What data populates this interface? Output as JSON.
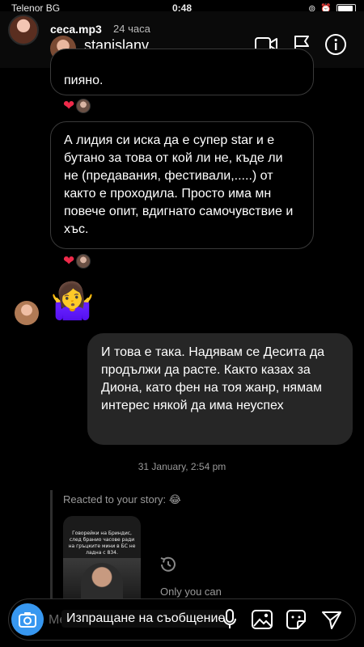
{
  "status_bar": {
    "carrier": "Telenor BG",
    "time": "0:48"
  },
  "header": {
    "story_user": "ceca.mp3",
    "story_age": "24 часа",
    "username": "stanislanv",
    "icons": [
      "video-call-icon",
      "flag-icon",
      "info-icon"
    ]
  },
  "messages": [
    {
      "id": "m1",
      "sender": "other",
      "text": "пияно.",
      "reaction": "heart"
    },
    {
      "id": "m2",
      "sender": "other",
      "text": "А лидия си иска да е супер star  и е бутано за това от кой ли не, къде ли не (предавания, фестивали,.....) от както е проходила. Просто има мн повече опит, вдигнато самочувствие и хъс.",
      "reaction": "heart"
    },
    {
      "id": "m3",
      "sender": "other",
      "text": "🤷‍♀️"
    },
    {
      "id": "m4",
      "sender": "me",
      "text": "И това е така. Надявам се Десита да продължи да расте. Както казах за Диона, като фен на тоя жанр, нямам интерес някой да има неуспех"
    }
  ],
  "timestamp": "31 January, 2:54 pm",
  "story_reply": {
    "label": "Reacted to your story: 😂",
    "thumb_text": "Говорейки на Бриндис, след бранио часове ради на гръцките мини в БС не ладна с 834.",
    "note": "Only you can"
  },
  "composer": {
    "placeholder": "Message...",
    "overlay_text": "Изпращане на съобщение",
    "icons": [
      "camera-icon",
      "microphone-icon",
      "gallery-icon",
      "sticker-icon",
      "send-icon"
    ]
  },
  "colors": {
    "accent": "#3797f0",
    "heart": "#ee2a4a",
    "my_bubble": "#262626"
  }
}
